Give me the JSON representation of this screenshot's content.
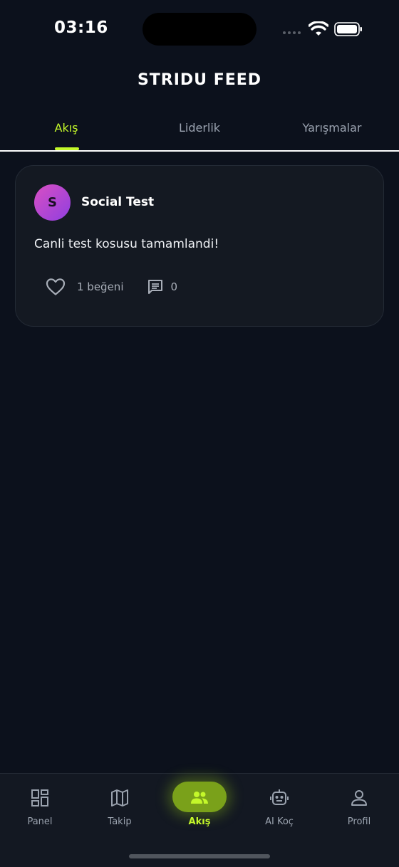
{
  "status_bar": {
    "time": "03:16"
  },
  "header": {
    "title": "STRIDU FEED"
  },
  "tabs": [
    {
      "label": "Akış",
      "active": true
    },
    {
      "label": "Liderlik",
      "active": false
    },
    {
      "label": "Yarışmalar",
      "active": false
    }
  ],
  "post": {
    "avatar_initial": "S",
    "author": "Social Test",
    "text": "Canli test kosusu tamamlandi!",
    "likes_label": "1 beğeni",
    "comments_count": "0"
  },
  "bottom_nav": [
    {
      "label": "Panel",
      "icon": "dashboard-icon"
    },
    {
      "label": "Takip",
      "icon": "map-icon"
    },
    {
      "label": "Akış",
      "icon": "people-icon",
      "active": true
    },
    {
      "label": "AI Koç",
      "icon": "robot-icon"
    },
    {
      "label": "Profil",
      "icon": "person-icon"
    }
  ],
  "colors": {
    "accent": "#c4f82a",
    "background": "#0c111c",
    "card": "#141922"
  }
}
